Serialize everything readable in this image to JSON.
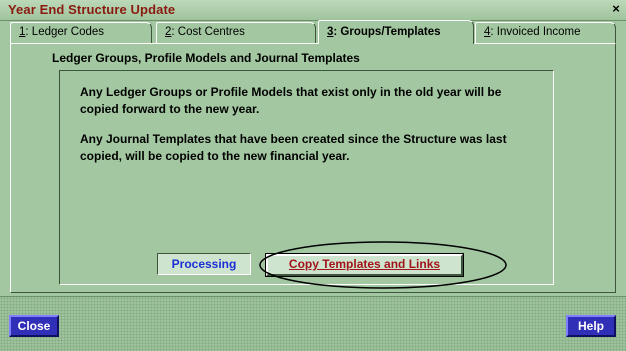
{
  "window": {
    "title": "Year End Structure Update",
    "close_glyph": "×"
  },
  "tabs": [
    {
      "key": "1",
      "label": ": Ledger Codes"
    },
    {
      "key": "2",
      "label": ": Cost Centres"
    },
    {
      "key": "3",
      "label": ": Groups/Templates"
    },
    {
      "key": "4",
      "label": ": Invoiced Income"
    }
  ],
  "active_tab": 2,
  "section": {
    "title": "Ledger Groups, Profile Models and Journal Templates"
  },
  "paragraphs": [
    "Any Ledger Groups or Profile Models that exist only in the old year will be copied forward to the new year.",
    "Any Journal Templates that have been created since the Structure was last copied, will be copied to the new financial year."
  ],
  "status": {
    "label": "Processing",
    "color": "#1a2fd6"
  },
  "actions": {
    "copy_label": "Copy Templates and Links"
  },
  "footer": {
    "close_label": "Close",
    "help_label": "Help"
  },
  "colors": {
    "window_bg": "#a3c8a1",
    "title_text": "#8a1a10",
    "button_blue": "#2f2fb8",
    "action_red": "#a0141a"
  }
}
